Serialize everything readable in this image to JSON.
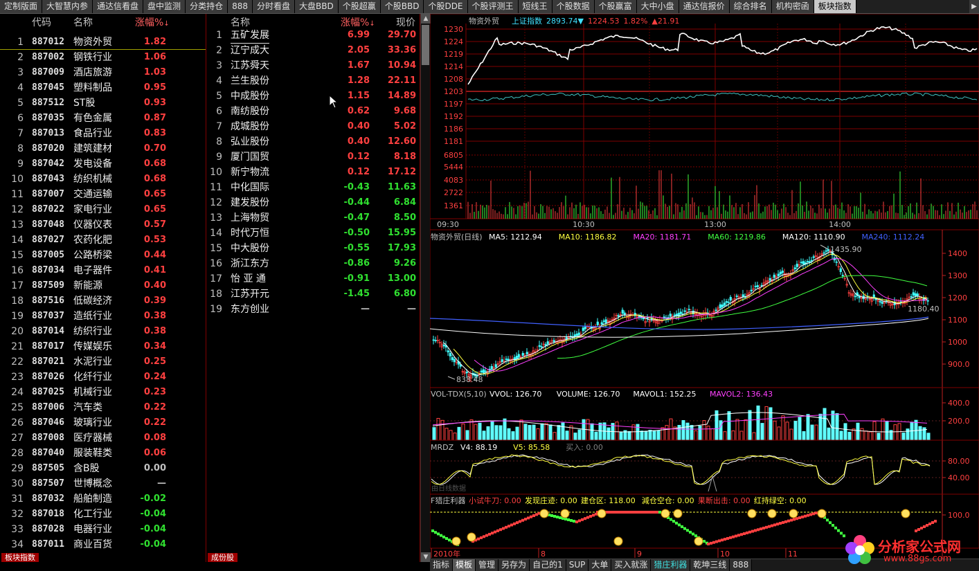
{
  "tabs": [
    "定制版面",
    "大智慧内参",
    "通达信看盘",
    "盘中监测",
    "分类持仓",
    "888",
    "分时看盘",
    "大盘BBD",
    "个股超赢",
    "个股BBD",
    "个股DDE",
    "个股评测王",
    "短线王",
    "个股数据",
    "个股赢富",
    "大中小盘",
    "通达信报价",
    "综合排名",
    "机构密函",
    "板块指数"
  ],
  "active_tab": "板块指数",
  "left": {
    "headers": {
      "code": "代码",
      "name": "名称",
      "pct": "涨幅%"
    },
    "rows": [
      [
        "1",
        "887012",
        "物资外贸",
        "1.82"
      ],
      [
        "2",
        "887002",
        "钢铁行业",
        "1.06"
      ],
      [
        "3",
        "887009",
        "酒店旅游",
        "1.03"
      ],
      [
        "4",
        "887045",
        "塑料制品",
        "0.95"
      ],
      [
        "5",
        "887512",
        "ST股",
        "0.93"
      ],
      [
        "6",
        "887035",
        "有色金属",
        "0.87"
      ],
      [
        "7",
        "887013",
        "食品行业",
        "0.83"
      ],
      [
        "8",
        "887020",
        "建筑建材",
        "0.70"
      ],
      [
        "9",
        "887042",
        "发电设备",
        "0.68"
      ],
      [
        "10",
        "887043",
        "纺织机械",
        "0.68"
      ],
      [
        "11",
        "887007",
        "交通运输",
        "0.65"
      ],
      [
        "12",
        "887022",
        "家电行业",
        "0.65"
      ],
      [
        "13",
        "887048",
        "仪器仪表",
        "0.57"
      ],
      [
        "14",
        "887027",
        "农药化肥",
        "0.53"
      ],
      [
        "15",
        "887005",
        "公路桥梁",
        "0.44"
      ],
      [
        "16",
        "887034",
        "电子器件",
        "0.41"
      ],
      [
        "17",
        "887509",
        "新能源",
        "0.40"
      ],
      [
        "18",
        "887516",
        "低碳经济",
        "0.39"
      ],
      [
        "19",
        "887037",
        "造纸行业",
        "0.38"
      ],
      [
        "20",
        "887014",
        "纺织行业",
        "0.38"
      ],
      [
        "21",
        "887017",
        "传媒娱乐",
        "0.34"
      ],
      [
        "22",
        "887021",
        "水泥行业",
        "0.25"
      ],
      [
        "23",
        "887026",
        "化纤行业",
        "0.24"
      ],
      [
        "24",
        "887025",
        "机械行业",
        "0.23"
      ],
      [
        "25",
        "887006",
        "汽车类",
        "0.22"
      ],
      [
        "26",
        "887046",
        "玻璃行业",
        "0.22"
      ],
      [
        "27",
        "887008",
        "医疗器械",
        "0.08"
      ],
      [
        "28",
        "887040",
        "服装鞋类",
        "0.06"
      ],
      [
        "29",
        "887505",
        "含B股",
        "0.00"
      ],
      [
        "30",
        "887507",
        "世博概念",
        "—"
      ],
      [
        "31",
        "887032",
        "船舶制造",
        "-0.02"
      ],
      [
        "32",
        "887018",
        "化工行业",
        "-0.04"
      ],
      [
        "33",
        "887028",
        "电器行业",
        "-0.04"
      ],
      [
        "34",
        "887011",
        "商业百货",
        "-0.04"
      ]
    ],
    "bottom_tab": "板块指数"
  },
  "mid": {
    "headers": {
      "name": "名称",
      "pct": "涨幅%",
      "price": "现价"
    },
    "rows": [
      [
        "1",
        "五矿发展",
        "6.99",
        "29.70"
      ],
      [
        "2",
        "辽宁成大",
        "2.05",
        "33.36"
      ],
      [
        "3",
        "江苏舜天",
        "1.67",
        "10.94"
      ],
      [
        "4",
        "兰生股份",
        "1.28",
        "22.11"
      ],
      [
        "5",
        "中成股份",
        "1.15",
        "14.89"
      ],
      [
        "6",
        "南纺股份",
        "0.62",
        "9.68"
      ],
      [
        "7",
        "成城股份",
        "0.40",
        "5.02"
      ],
      [
        "8",
        "弘业股份",
        "0.40",
        "12.60"
      ],
      [
        "9",
        "厦门国贸",
        "0.12",
        "8.18"
      ],
      [
        "10",
        "新宁物流",
        "0.12",
        "17.12"
      ],
      [
        "11",
        "中化国际",
        "-0.43",
        "11.63"
      ],
      [
        "12",
        "建发股份",
        "-0.44",
        "6.84"
      ],
      [
        "13",
        "上海物贸",
        "-0.47",
        "8.50"
      ],
      [
        "14",
        "时代万恒",
        "-0.50",
        "15.95"
      ],
      [
        "15",
        "中大股份",
        "-0.55",
        "17.93"
      ],
      [
        "16",
        "浙江东方",
        "-0.86",
        "9.26"
      ],
      [
        "17",
        "怡 亚 通",
        "-0.91",
        "13.00"
      ],
      [
        "18",
        "江苏开元",
        "-1.45",
        "6.80"
      ],
      [
        "19",
        "东方创业",
        "—",
        "—"
      ]
    ],
    "bottom_tab": "成份股"
  },
  "intraday": {
    "title": "物资外贸",
    "index_label": "上证指数",
    "index_value": "2893.74▼",
    "price": "1224.53",
    "pct": "1.82%",
    "chg": "▲21.91",
    "yticks": [
      "1230",
      "1224",
      "1219",
      "1214",
      "1208",
      "1203",
      "1197",
      "1192",
      "1186",
      "1181"
    ],
    "vticks": [
      "6805",
      "5444",
      "4083",
      "2722",
      "1361"
    ],
    "times": [
      "09:30",
      "10:30",
      "13:00",
      "14:00"
    ]
  },
  "kline": {
    "title": "物资外贸(日线)",
    "ma": [
      {
        "t": "MA5: 1212.94",
        "c": "#ffffff"
      },
      {
        "t": "MA10: 1186.82",
        "c": "#ffff40"
      },
      {
        "t": "MA20: 1181.71",
        "c": "#ff40ff"
      },
      {
        "t": "MA60: 1219.86",
        "c": "#40ff40"
      },
      {
        "t": "MA120: 1110.90",
        "c": "#ffffff"
      },
      {
        "t": "MA240: 1112.24",
        "c": "#4060ff"
      }
    ],
    "yticks": [
      "1400",
      "1300",
      "1200",
      "1100",
      "1000",
      "900.0"
    ],
    "high_label": "1435.90",
    "low_label": "838.48",
    "last_label": "1180.40"
  },
  "vol": {
    "title": "VOL-TDX(5,10)",
    "items": [
      {
        "t": "VVOL: 126.70",
        "c": "#ffffff"
      },
      {
        "t": "VOLUME: 126.70",
        "c": "#ffffff"
      },
      {
        "t": "MAVOL1: 152.25",
        "c": "#ffffff"
      },
      {
        "t": "MAVOL2: 136.43",
        "c": "#ff40ff"
      }
    ],
    "yticks": [
      "400.0",
      "200.0"
    ]
  },
  "mrdz": {
    "title": "MRDZ",
    "items": [
      {
        "t": "V4: 88.19",
        "c": "#ffffff"
      },
      {
        "t": "V5: 85.58",
        "c": "#ffff40"
      },
      {
        "t": "买入: 0.00",
        "c": "#808080"
      }
    ],
    "yticks": [
      "80.00",
      "40.00"
    ],
    "overlay": "由日线数据"
  },
  "zhuang": {
    "title": "F猎庄利器",
    "items": [
      {
        "t": "小试牛刀: 0.00",
        "c": "#ff4040"
      },
      {
        "t": "发现庄迹: 0.00",
        "c": "#ffff40"
      },
      {
        "t": "建仓区: 118.00",
        "c": "#ffff40"
      },
      {
        "t": "減仓空仓: 0.00",
        "c": "#ffff40"
      },
      {
        "t": "果断出击: 0.00",
        "c": "#ff4040"
      },
      {
        "t": "红持绿空: 0.00",
        "c": "#ffff40"
      }
    ],
    "yticks": [
      "100.0"
    ]
  },
  "xaxis": [
    "2010年",
    "8",
    "9",
    "10",
    "11"
  ],
  "bottom_bar": [
    "指标",
    "模板",
    "管理",
    "另存为",
    "自己的1",
    "SUP",
    "大单",
    "买入就涨",
    "猎庄利器",
    "乾坤三线",
    "888"
  ],
  "bottom_active": "模板",
  "watermark": {
    "t1": "分析家公式网",
    "t2": "www.88gs.com"
  }
}
